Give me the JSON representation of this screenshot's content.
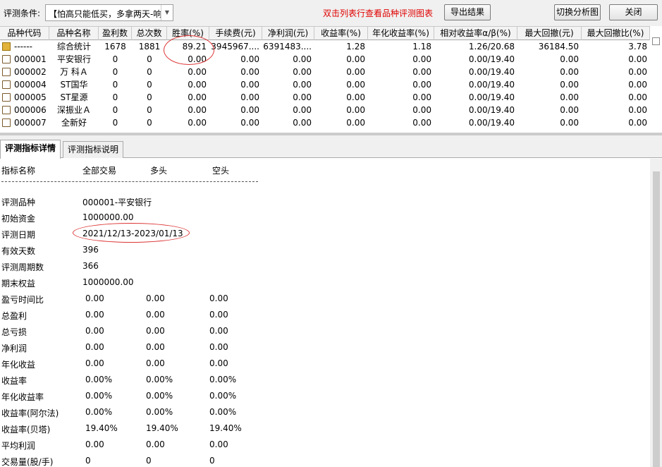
{
  "toolbar": {
    "condition_label": "评测条件:",
    "condition_value": "【怕高只能低买，多拿两天-响",
    "hint": "双击列表行查看品种评测图表",
    "export_button": "导出结果",
    "switch_button": "切换分析图",
    "close_button": "关闭"
  },
  "table": {
    "columns": [
      "品种代码",
      "品种名称",
      "盈利数",
      "总次数",
      "胜率(%)",
      "手续费(元)",
      "净利润(元)",
      "收益率(%)",
      "年化收益率(%)",
      "相对收益率α/β(%)",
      "最大回撤(元)",
      "最大回撤比(%)"
    ],
    "rows": [
      {
        "icon": "summary-icon",
        "code": "------",
        "name": "综合统计",
        "wins": "1678",
        "total": "1881",
        "winrate": "89.21",
        "fee": "3945967....",
        "profit": "6391483....",
        "ret": "1.28",
        "annual": "1.18",
        "relative": "1.26/20.68",
        "maxdd": "36184.50",
        "maxddr": "3.78"
      },
      {
        "icon": "document-icon",
        "code": "000001",
        "name": "平安银行",
        "wins": "0",
        "total": "0",
        "winrate": "0.00",
        "fee": "0.00",
        "profit": "0.00",
        "ret": "0.00",
        "annual": "0.00",
        "relative": "0.00/19.40",
        "maxdd": "0.00",
        "maxddr": "0.00"
      },
      {
        "icon": "document-icon",
        "code": "000002",
        "name": "万 科Ａ",
        "wins": "0",
        "total": "0",
        "winrate": "0.00",
        "fee": "0.00",
        "profit": "0.00",
        "ret": "0.00",
        "annual": "0.00",
        "relative": "0.00/19.40",
        "maxdd": "0.00",
        "maxddr": "0.00"
      },
      {
        "icon": "document-icon",
        "code": "000004",
        "name": "ST国华",
        "wins": "0",
        "total": "0",
        "winrate": "0.00",
        "fee": "0.00",
        "profit": "0.00",
        "ret": "0.00",
        "annual": "0.00",
        "relative": "0.00/19.40",
        "maxdd": "0.00",
        "maxddr": "0.00"
      },
      {
        "icon": "document-icon",
        "code": "000005",
        "name": "ST星源",
        "wins": "0",
        "total": "0",
        "winrate": "0.00",
        "fee": "0.00",
        "profit": "0.00",
        "ret": "0.00",
        "annual": "0.00",
        "relative": "0.00/19.40",
        "maxdd": "0.00",
        "maxddr": "0.00"
      },
      {
        "icon": "document-icon",
        "code": "000006",
        "name": "深振业Ａ",
        "wins": "0",
        "total": "0",
        "winrate": "0.00",
        "fee": "0.00",
        "profit": "0.00",
        "ret": "0.00",
        "annual": "0.00",
        "relative": "0.00/19.40",
        "maxdd": "0.00",
        "maxddr": "0.00"
      },
      {
        "icon": "document-icon",
        "code": "000007",
        "name": "全新好",
        "wins": "0",
        "total": "0",
        "winrate": "0.00",
        "fee": "0.00",
        "profit": "0.00",
        "ret": "0.00",
        "annual": "0.00",
        "relative": "0.00/19.40",
        "maxdd": "0.00",
        "maxddr": "0.00"
      }
    ]
  },
  "tabs": [
    {
      "label": "评测指标详情",
      "active": true
    },
    {
      "label": "评测指标说明",
      "active": false
    }
  ],
  "detail": {
    "header": {
      "name": "指标名称",
      "all": "全部交易",
      "long": "多头",
      "short": "空头"
    },
    "rows": [
      {
        "label": "评测品种",
        "v1": "000001-平安银行",
        "v2": "",
        "v3": ""
      },
      {
        "label": "初始资金",
        "v1": "1000000.00",
        "v2": "",
        "v3": ""
      },
      {
        "label": "评测日期",
        "v1": "2021/12/13-2023/01/13",
        "v2": "",
        "v3": ""
      },
      {
        "label": "有效天数",
        "v1": "396",
        "v2": "",
        "v3": ""
      },
      {
        "label": "评测周期数",
        "v1": "366",
        "v2": "",
        "v3": ""
      },
      {
        "label": "期末权益",
        "v1": "1000000.00",
        "v2": "",
        "v3": ""
      },
      {
        "label": "盈亏时间比",
        "v1": "0.00",
        "v2": "0.00",
        "v3": "0.00"
      },
      {
        "label": "总盈利",
        "v1": "0.00",
        "v2": "0.00",
        "v3": "0.00"
      },
      {
        "label": "总亏损",
        "v1": "0.00",
        "v2": "0.00",
        "v3": "0.00"
      },
      {
        "label": "净利润",
        "v1": "0.00",
        "v2": "0.00",
        "v3": "0.00"
      },
      {
        "label": "年化收益",
        "v1": "0.00",
        "v2": "0.00",
        "v3": "0.00"
      },
      {
        "label": "收益率",
        "v1": "0.00%",
        "v2": "0.00%",
        "v3": "0.00%"
      },
      {
        "label": "年化收益率",
        "v1": "0.00%",
        "v2": "0.00%",
        "v3": "0.00%"
      },
      {
        "label": "收益率(阿尔法)",
        "v1": "0.00%",
        "v2": "0.00%",
        "v3": "0.00%"
      },
      {
        "label": "收益率(贝塔)",
        "v1": "19.40%",
        "v2": "19.40%",
        "v3": "19.40%"
      },
      {
        "label": "平均利润",
        "v1": "0.00",
        "v2": "0.00",
        "v3": "0.00"
      },
      {
        "label": "交易量(股/手)",
        "v1": "0",
        "v2": "0",
        "v3": "0"
      }
    ]
  },
  "colors": {
    "hint": "#e00000",
    "annotation": "#dd3333"
  }
}
